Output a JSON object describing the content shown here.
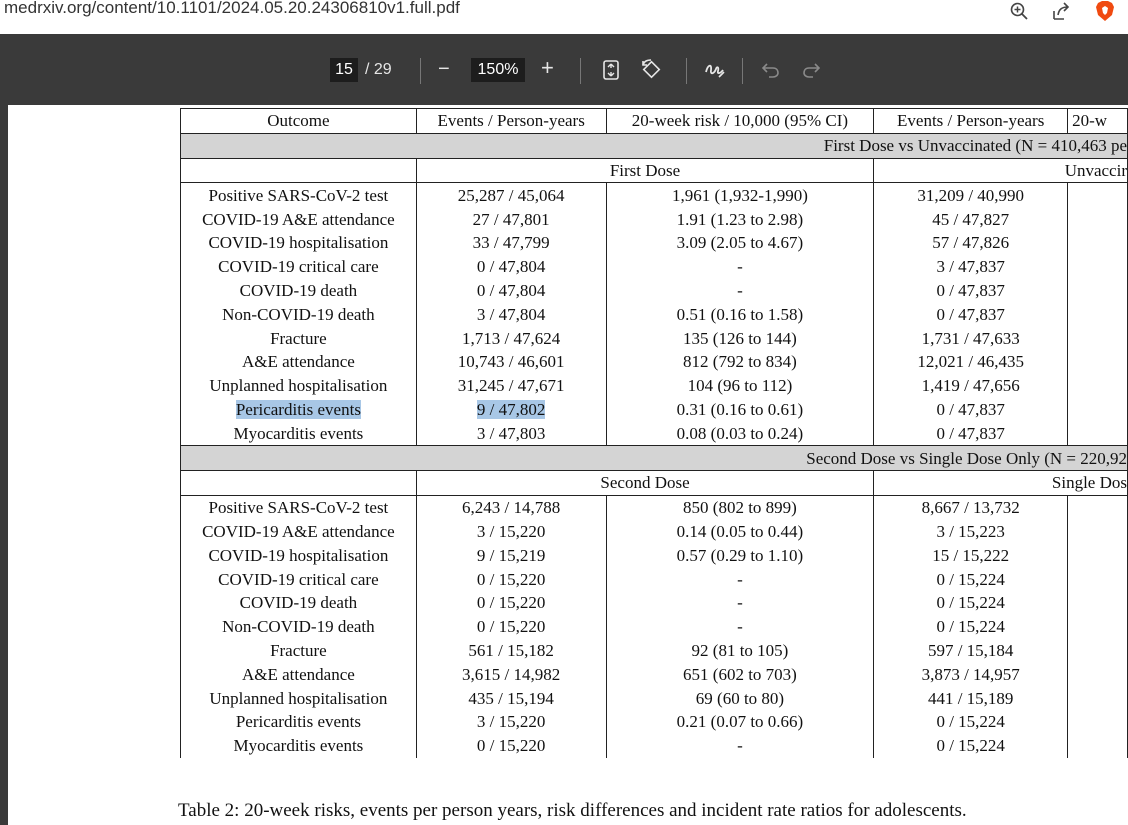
{
  "browser": {
    "url": "medrxiv.org/content/10.1101/2024.05.20.24306810v1.full.pdf",
    "icons": [
      "zoom-in-icon",
      "share-icon",
      "brave-shield-icon"
    ]
  },
  "pdf_toolbar": {
    "page_current": "15",
    "page_total": "/ 29",
    "zoom_out": "−",
    "zoom_level": "150%",
    "zoom_in": "+",
    "icons": [
      "fit-page-icon",
      "rotate-icon",
      "draw-icon",
      "undo-icon",
      "redo-icon"
    ]
  },
  "table": {
    "headers": [
      "Outcome",
      "Events / Person-years",
      "20-week risk  / 10,000 (95% CI)",
      "Events / Person-years",
      "20-w"
    ],
    "section1": {
      "title": "First Dose vs Unvaccinated (N = 410,463 pe",
      "group_left": "First Dose",
      "group_right": "Unvaccir",
      "rows": [
        [
          "Positive SARS-CoV-2 test",
          "25,287 / 45,064",
          "1,961 (1,932-1,990)",
          "31,209 / 40,990"
        ],
        [
          "COVID-19 A&E attendance",
          "27 / 47,801",
          "1.91 (1.23 to 2.98)",
          "45 / 47,827"
        ],
        [
          "COVID-19 hospitalisation",
          "33 / 47,799",
          "3.09 (2.05 to 4.67)",
          "57 / 47,826"
        ],
        [
          "COVID-19 critical care",
          "0 / 47,804",
          "-",
          "3 / 47,837"
        ],
        [
          "COVID-19 death",
          "0 / 47,804",
          "-",
          "0 / 47,837"
        ],
        [
          "Non-COVID-19 death",
          "3 / 47,804",
          "0.51 (0.16 to 1.58)",
          "0 / 47,837"
        ],
        [
          "Fracture",
          "1,713 / 47,624",
          "135 (126 to 144)",
          "1,731 / 47,633"
        ],
        [
          "A&E attendance",
          "10,743 / 46,601",
          "812 (792 to 834)",
          "12,021 / 46,435"
        ],
        [
          "Unplanned hospitalisation",
          "31,245 / 47,671",
          "104 (96 to 112)",
          "1,419 / 47,656"
        ],
        [
          "Pericarditis events",
          "9 / 47,802",
          "0.31 (0.16 to 0.61)",
          "0 / 47,837"
        ],
        [
          "Myocarditis events",
          "3 / 47,803",
          "0.08 (0.03 to 0.24)",
          "0 / 47,837"
        ]
      ]
    },
    "section2": {
      "title": "Second Dose vs Single Dose Only (N = 220,92",
      "group_left": "Second Dose",
      "group_right": "Single Dos",
      "rows": [
        [
          "Positive SARS-CoV-2 test",
          "6,243 / 14,788",
          "850 (802 to 899)",
          "8,667 / 13,732"
        ],
        [
          "COVID-19 A&E attendance",
          "3 / 15,220",
          "0.14 (0.05 to 0.44)",
          "3 / 15,223"
        ],
        [
          "COVID-19 hospitalisation",
          "9 / 15,219",
          "0.57 (0.29 to 1.10)",
          "15 / 15,222"
        ],
        [
          "COVID-19 critical care",
          "0 / 15,220",
          "-",
          "0 / 15,224"
        ],
        [
          "COVID-19 death",
          "0 / 15,220",
          "-",
          "0 / 15,224"
        ],
        [
          "Non-COVID-19 death",
          "0 / 15,220",
          "-",
          "0 / 15,224"
        ],
        [
          "Fracture",
          "561 / 15,182",
          "92 (81 to 105)",
          "597 / 15,184"
        ],
        [
          "A&E attendance",
          "3,615 / 14,982",
          "651 (602 to 703)",
          "3,873 / 14,957"
        ],
        [
          "Unplanned hospitalisation",
          "435 / 15,194",
          "69 (60 to 80)",
          "441 / 15,189"
        ],
        [
          "Pericarditis events",
          "3 / 15,220",
          "0.21 (0.07 to 0.66)",
          "0 / 15,224"
        ],
        [
          "Myocarditis events",
          "0 / 15,220",
          "-",
          "0 / 15,224"
        ]
      ]
    },
    "highlighted": [
      "Pericarditis events",
      "9 / 47,802"
    ],
    "highlight_color": "#a8c7e6"
  },
  "caption": "Table 2: 20-week risks, events per person years, risk differences and incident rate ratios for adolescents."
}
